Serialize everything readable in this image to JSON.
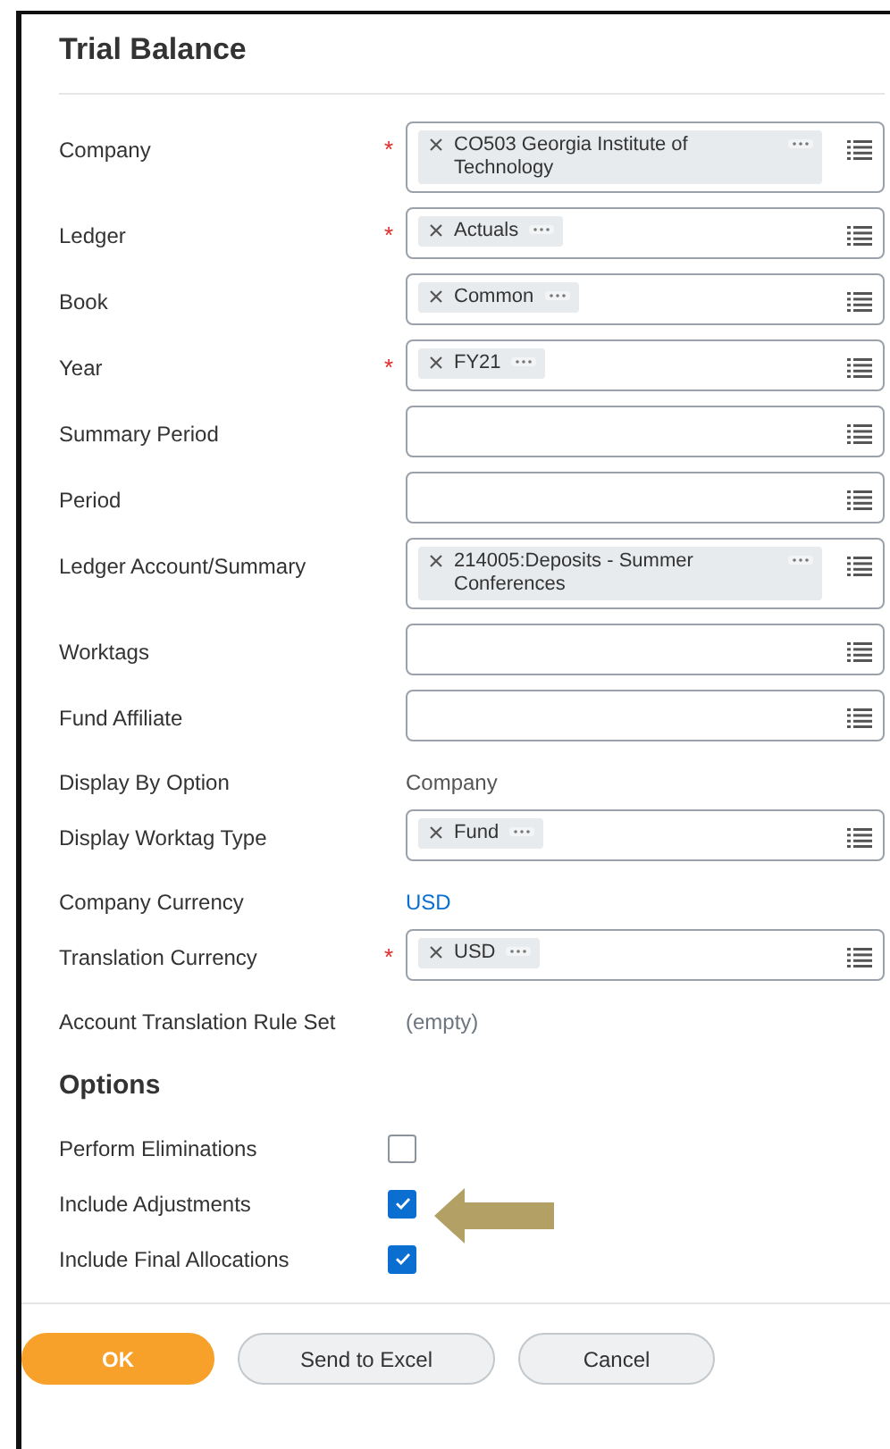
{
  "title": "Trial Balance",
  "fields": [
    {
      "label": "Company",
      "required_mark": "*",
      "kind": "prompt",
      "chips": [
        "CO503 Georgia Institute of Technology"
      ]
    },
    {
      "label": "Ledger",
      "required_mark": "*",
      "kind": "prompt",
      "chips": [
        "Actuals"
      ]
    },
    {
      "label": "Book",
      "kind": "prompt",
      "chips": [
        "Common"
      ]
    },
    {
      "label": "Year",
      "required_mark": "*",
      "kind": "prompt",
      "chips": [
        "FY21"
      ]
    },
    {
      "label": "Summary Period",
      "kind": "prompt"
    },
    {
      "label": "Period",
      "kind": "prompt"
    },
    {
      "label": "Ledger Account/Summary",
      "kind": "prompt",
      "chips": [
        "214005:Deposits - Summer Conferences"
      ]
    },
    {
      "label": "Worktags",
      "kind": "prompt"
    },
    {
      "label": "Fund Affiliate",
      "kind": "prompt"
    },
    {
      "label": "Display By Option",
      "kind": "text",
      "value": "Company"
    },
    {
      "label": "Display Worktag Type",
      "kind": "prompt",
      "chips": [
        "Fund"
      ]
    },
    {
      "label": "Company Currency",
      "kind": "link",
      "value": "USD"
    },
    {
      "label": "Translation Currency",
      "required_mark": "*",
      "kind": "prompt",
      "chips": [
        "USD"
      ]
    },
    {
      "label": "Account Translation Rule Set",
      "kind": "empty",
      "value": "(empty)"
    }
  ],
  "options_heading": "Options",
  "options": [
    {
      "label": "Perform Eliminations",
      "checked": false
    },
    {
      "label": "Include Adjustments",
      "checked": true
    },
    {
      "label": "Include Final Allocations",
      "checked": true
    }
  ],
  "buttons": [
    {
      "label": "OK",
      "kind": "primary"
    },
    {
      "label": "Send to Excel",
      "kind": "secondary"
    },
    {
      "label": "Cancel",
      "kind": "secondary"
    }
  ]
}
